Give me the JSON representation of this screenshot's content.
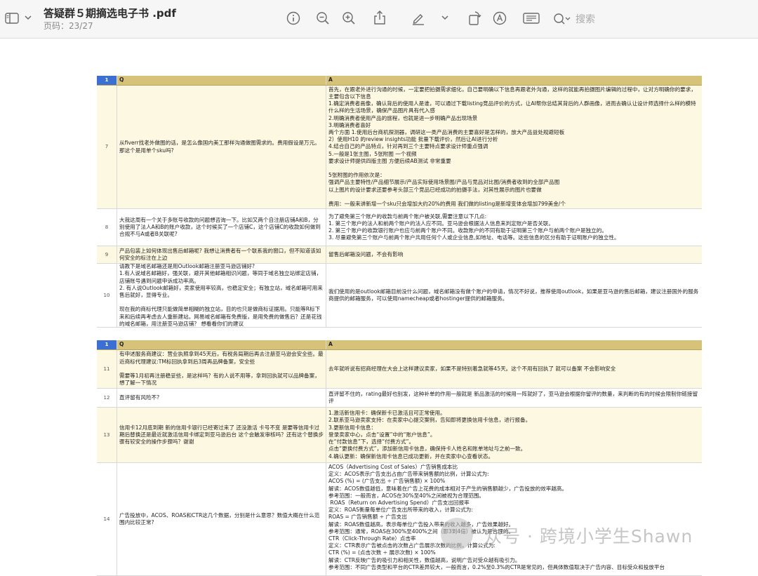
{
  "toolbar": {
    "title": "答疑群５期摘选电子书 .pdf",
    "page_label": "页码：",
    "page_value": "23/27",
    "search_placeholder": "搜索",
    "icons": [
      "sidebar-icon",
      "chevron-down-icon",
      "info-icon",
      "zoom-out-icon",
      "zoom-in-icon",
      "share-icon",
      "markup-pen-icon",
      "chevron-down-icon",
      "rotate-icon",
      "annotate-icon",
      "form-fill-icon",
      "search-icon"
    ]
  },
  "table1": {
    "header": {
      "num": "1",
      "q": "Q",
      "a": "A"
    },
    "rows": [
      {
        "num": "7",
        "q": "从fiverr找老外做图的话，是怎么像国内美工那样沟通做图需求的。费用假设是万元。那这个是用单个sku吗?",
        "a": "首先，在跟老外进行沟通的时候，一定要把拍摄需求细化，自己要明确以下信息再跟老外沟通，这样的就能再拍摄图片编辑的过程中，让对方明确你的要求，主要包含以下信息\n1.确定消费者画像，确认背后的使用人是谁，可以通过下载listing竞品评价的方式，让AI帮你总结其背后的人群画像，进而去确认让设计师选择什么样的模特 什么样的生活场景，确保产品图片具有代入感\n2.明确消费者使用产品的旅程，也就是进一步明确产品出现场景\n3.明确消费者喜好\n两个方面 1.使用后台商机探测器，调研这一类产品消费的主要喜好是怎样的，放大产品益处规避短板\n2）使用H10 的review insights功能 批量下载评价，然后让AI进行分析\n4.结合自己的产品特点，针对再到三个主要特点要求设计师重点强调\n5.一般是1张主图，5张附图 一个视频\n要求设计师提供四版主图 方便后续AB测试 非常重要\n\n5张附图的作用依次是：\n强调产品主要特性/产品细节展示/产品实际使用场景图/产品与竞品对比图/消费者收到的全部产品图\n以上图片的设计要求还要参考头部三个竞品已经成功的拍摄手法，对其性展示的图片也要做\n\n费用：一般来讲新增一个sku只会增加大约20%的费用 我们做的listing是新增变体会增加799美金/个"
      },
      {
        "num": "8",
        "q": "大我这周有一个关于多账号收款的问题想咨询一下。比如又两个自注册店铺A和B，分别使用了法人A和B的账户收款，这个时候买了一个店铺C，这个店铺C的收款如何做到合规不与A或者B关联呢?",
        "a": "为了避免第三个账户的收款与前两个账户被关联,需要注意以下几点:\n1. 第三个账户的法人和前两个账户的法人应不同。亚马逊会根据法人信息来判定账户是否关联。\n2. 第三个账户的收款银行账户也应与前两个账户不同。收款账户的不同有助于证明第三个账户与前两个账户是独立的。\n3. 尽量避免第三个账户与前两个账户共用任何个人或企业信息,如地址、电话等。这些信息的区分有助于证明账户的独立性。"
      },
      {
        "num": "9",
        "q": "产品包装上如何体现出售后邮箱呢? 我想让消费者有一个联系我的窗口，但不知道该如何安全的标注在上边",
        "a": "留售后邮箱没问题，不会有影响"
      },
      {
        "num": "10",
        "q": "请教下是域名邮箱还是用Outlook邮箱注册亚马逊店铺好?\n1.有人说域名邮箱好，强关联，避开其他邮箱相识问题，等同于域名独立站绑定店铺，店铺账号遇到问题申诉成功率高。\n2. 有人说Outlook邮箱好，卖家使用率较高，也稳定安全；有独立站，域名邮箱可用来售后就好，显得专业。\n\n现在我的商标代理只能做简单相糊的独立站，目的也只是做商标证据用。只能等R标下来和后续再考虑去人重新建站。网易域名邮箱有免费版，是用免费的做售后？还是花钱的域名邮箱，用注册亚马逊店铺？ 想看看你们的建议",
        "a": "我们使用的是outlook邮箱目前没什么问题，域名邮箱没有做个账户的申请，情况不好说，推荐使用outlook，如果是亚马逊的售后邮箱，建议注册国外的服务商提供的邮箱服务，可以使用namecheap或者hostinger提供的邮箱服务。"
      }
    ]
  },
  "table2": {
    "header": {
      "num": "1",
      "q": "Q",
      "a": "A"
    },
    "rows": [
      {
        "num": "11",
        "q": "有申述服务商建议：营业执照拿到45天后，有税务局期后再去注册亚马逊会安全些。最近商标代理建议:TM标回执拿到后3周再品牌备案，安全些\n\n需要等1月初再注册稳妥些，是这样吗？有的人说不用等，拿到回执就可以品牌备案，想了解一下情况",
        "a": "去年就听说有招商经理在大会上这样建议卖家，如果不是特别着急就等45天。这个不用有回执了 就可以备案 不会影响安全"
      },
      {
        "num": "12",
        "q": "直评留有风险不?",
        "a": "直评留不住的，rating最好也别发，这种补单的作用一般就是 新品激活的时候用一阵就好了，亚马逊会根据你留评的数量，来判断的有的时候会限制你链接留评"
      },
      {
        "num": "13",
        "q": "信用卡12月底到期 新的信用卡银行已经寄过来了 还没激活 卡号不变 是要等信用卡过期后替换还是最近就激活信用卡绑定到亚马逊后台 这个会触发审核吗？还有这个替换步骤有较安全的操作步骤吗？谢谢",
        "a": "1.激活新信用卡：确保新卡已激活且可正常使用。\n2.联系亚马逊卖家支持：在卖家中心提交案例，告知即将更换信用卡信息，进行报备。\n3.更新信用卡信息：\n登录卖家中心，点击“设置”中的“账户信息”。\n在“付款信息”下，选择“付费方式”。\n点击“更换付费方式”，添加新信用卡信息，确保持卡人姓名和账单地址与之前一致。\n4.确认更新：确保新信用卡信息已成功更新，并在卖家中心查看状态。"
      },
      {
        "num": "14",
        "q": "广告投放中，ACOS、ROAS和CTR这几个数据，分别是什么意思？数值大概在什么范围内比较正常?",
        "a": "ACOS（Advertising Cost of Sales）广告销售成本比\n定义：ACOS表示广告支出占由广告带来销售额的比例，计算公式为:\nACOS (%) = (广告支出 ÷ 广告销售额) × 100%\n解读：ACOS数值越低，意味着在广告上花费的成本相对于产生的销售额越少，广告投放的效率越高。\n参考范围：一般而言，ACOS在30%至40%之间被视为合理范围。\n ROAS（Return on Advertising Spend）广告支出回报率\n定义：ROAS衡量每单位广告支出所带来的收入，计算公式为:\nROAS = 广告销售额 ÷ 广告支出\n解读：ROAS数值越高，表示每单位广告投入带来的收入越多，广告效果越好。\n参考范围：通常，ROAS在300%至400%之间（即3到4倍）被认为是合理的。\nCTR（Click-Through Rate）点击率\n定义：CTR表示广告被点击的次数占广告展示次数的比例，计算公式为:\nCTR (%) = (点击次数 ÷ 展示次数) × 100%\n解读：CTR反映广告的吸引力和相关性，数值越高，说明广告对受众越有吸引力。\n参考范围：不同广告类型和平台的CTR差异较大，一般而言，0.2%至0.3%的CTR是常见的，但具体数值取决于广告内容、目标受众和投放平台"
      }
    ]
  },
  "watermark": "众号 · 跨境小学生Shawn"
}
